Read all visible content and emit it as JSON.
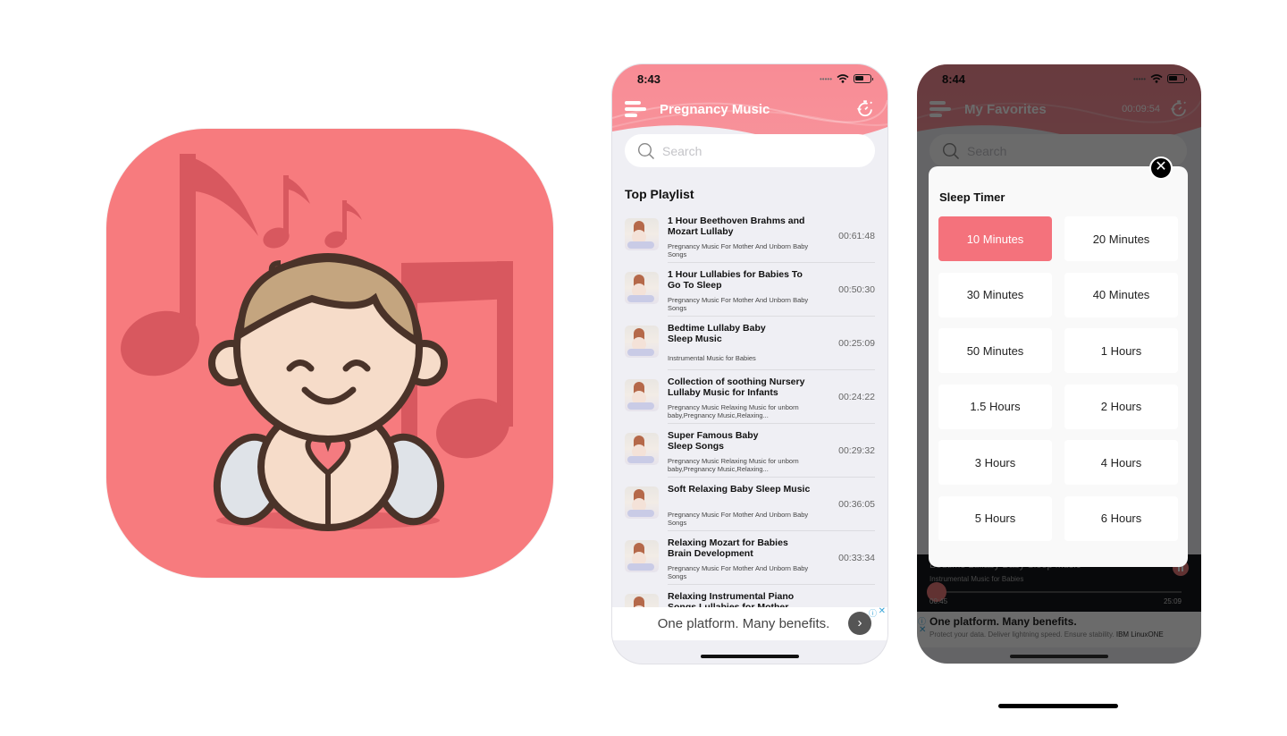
{
  "colors": {
    "brand_pink": "#f77b7e",
    "header_pink": "#f88c95",
    "selected_option": "#f4727c",
    "note_dark": "#d8585f"
  },
  "app_icon": {
    "name": "baby-music-app-icon"
  },
  "phone1": {
    "status": {
      "time": "8:43"
    },
    "nav": {
      "title": "Pregnancy Music",
      "menu_icon": "hamburger-menu-icon",
      "timer_icon": "sleep-timer-icon"
    },
    "search": {
      "placeholder": "Search"
    },
    "section_title": "Top Playlist",
    "playlist": [
      {
        "title": "1 Hour Beethoven Brahms and Mozart Lullaby",
        "subtitle": "Pregnancy Music For Mother And Unborn Baby Songs",
        "duration": "00:61:48"
      },
      {
        "title": "1 Hour Lullabies for Babies To Go To Sleep",
        "subtitle": "Pregnancy Music For Mother And Unborn Baby Songs",
        "duration": "00:50:30"
      },
      {
        "title": "Bedtime Lullaby Baby Sleep Music",
        "subtitle": "Instrumental Music for Babies",
        "duration": "00:25:09"
      },
      {
        "title": "Collection of soothing Nursery Lullaby Music for Infants",
        "subtitle": "Pregnancy Music Relaxing Music for unborn baby,Pregnancy Music,Relaxing...",
        "duration": "00:24:22"
      },
      {
        "title": "Super Famous Baby Sleep Songs",
        "subtitle": "Pregnancy Music Relaxing Music for unborn baby,Pregnancy Music,Relaxing...",
        "duration": "00:29:32"
      },
      {
        "title": "Soft Relaxing Baby Sleep Music",
        "subtitle": "Pregnancy Music For Mother And Unborn Baby Songs",
        "duration": "00:36:05"
      },
      {
        "title": "Relaxing Mozart for Babies Brain Development",
        "subtitle": "Pregnancy Music For Mother And Unborn Baby Songs",
        "duration": "00:33:34"
      },
      {
        "title": "Relaxing Instrumental Piano Songs Lullabies for Mother an...",
        "subtitle": "",
        "duration": ""
      }
    ],
    "ad": {
      "text": "One platform. Many benefits.",
      "arrow": "›",
      "info": "ⓘ",
      "close": "✕"
    }
  },
  "phone2": {
    "status": {
      "time": "8:44"
    },
    "nav": {
      "title": "My Favorites",
      "timer_readout": "00:09:54"
    },
    "search": {
      "placeholder": "Search"
    },
    "modal": {
      "title": "Sleep Timer",
      "close": "✕",
      "options": [
        {
          "label": "10 Minutes",
          "selected": true
        },
        {
          "label": "20 Minutes",
          "selected": false
        },
        {
          "label": "30 Minutes",
          "selected": false
        },
        {
          "label": "40 Minutes",
          "selected": false
        },
        {
          "label": "50 Minutes",
          "selected": false
        },
        {
          "label": "1 Hours",
          "selected": false
        },
        {
          "label": "1.5 Hours",
          "selected": false
        },
        {
          "label": "2 Hours",
          "selected": false
        },
        {
          "label": "3 Hours",
          "selected": false
        },
        {
          "label": "4 Hours",
          "selected": false
        },
        {
          "label": "5 Hours",
          "selected": false
        },
        {
          "label": "6 Hours",
          "selected": false
        }
      ]
    },
    "player": {
      "title": "Bedtime Lullaby Baby Sleep Music",
      "subtitle": "Instrumental Music for Babies",
      "current_time": "00:45",
      "total_time": "25:09",
      "progress": 0.03
    },
    "ad": {
      "title": "One platform. Many benefits.",
      "subtitle": "Protect your data. Deliver lightning speed. Ensure stability.",
      "brand": "IBM LinuxONE",
      "info": "ⓘ",
      "close": "✕"
    }
  }
}
